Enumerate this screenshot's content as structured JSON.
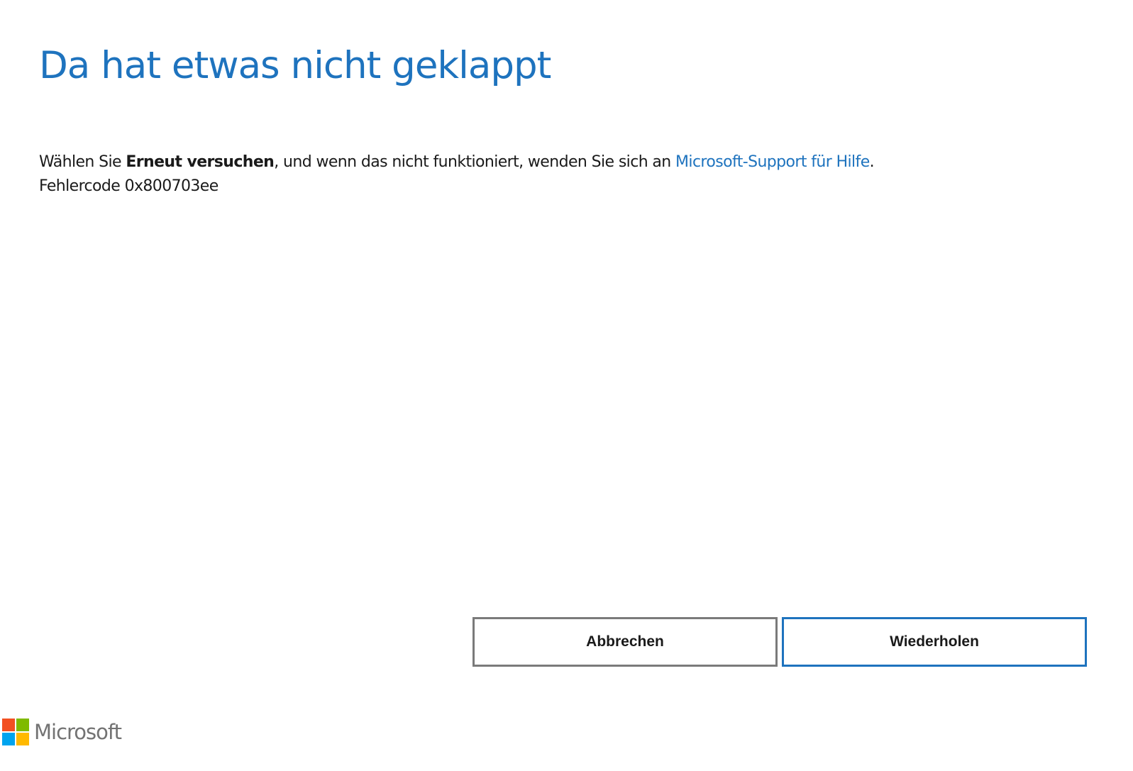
{
  "dialog": {
    "title": "Da hat etwas nicht geklappt",
    "message": {
      "prefix": "Wählen Sie ",
      "bold": "Erneut versuchen",
      "middle": ", und wenn das nicht funktioniert, wenden Sie sich an ",
      "link": "Microsoft-Support für Hilfe",
      "suffix": "."
    },
    "error_code": "Fehlercode 0x800703ee"
  },
  "buttons": {
    "cancel_label": "Abbrechen",
    "retry_label": "Wiederholen"
  },
  "footer": {
    "logo_text": "Microsoft",
    "logo_icon": "microsoft-logo-icon"
  },
  "colors": {
    "accent": "#1e73be",
    "cancel_border": "#7a7a7a",
    "logo_red": "#f25022",
    "logo_green": "#7fba00",
    "logo_blue": "#00a4ef",
    "logo_yellow": "#ffb900"
  }
}
